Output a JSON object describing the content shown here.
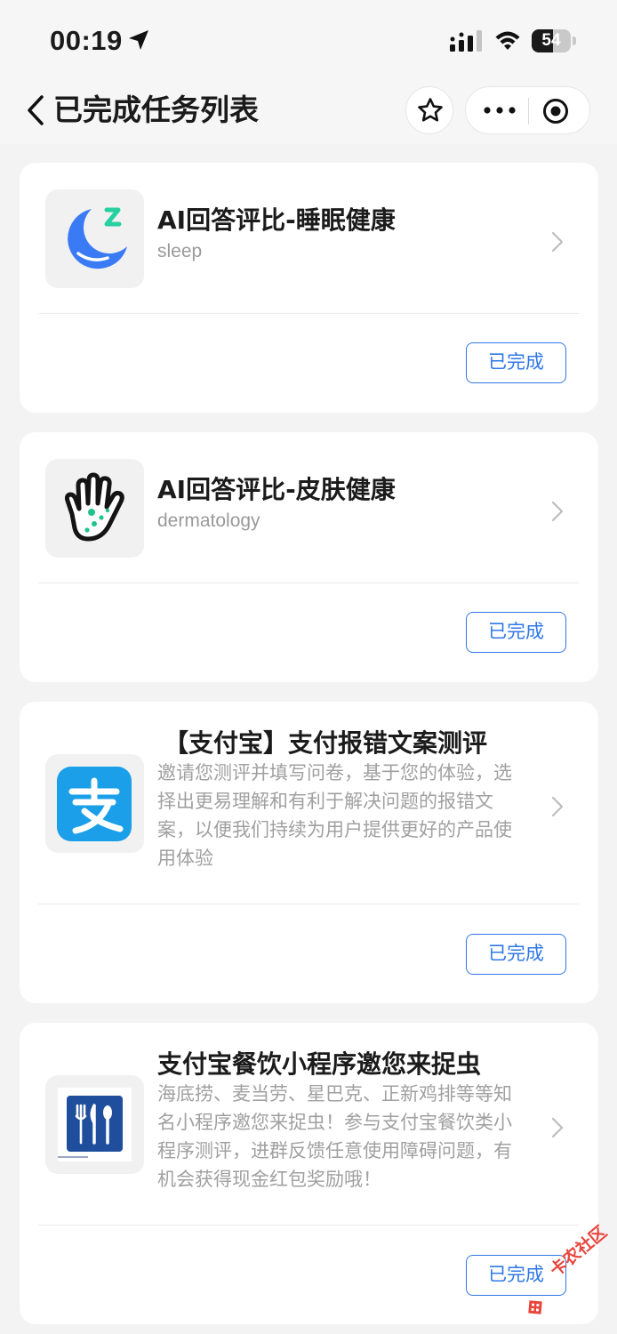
{
  "status_bar": {
    "time": "00:19",
    "battery_level": "54",
    "battery_fraction": 0.54,
    "icons": [
      "location-arrow-icon",
      "cellular-signal-icon",
      "wifi-icon",
      "battery-icon"
    ]
  },
  "nav": {
    "back_icon": "chevron-left-icon",
    "title": "已完成任务列表",
    "favorite_icon": "star-icon",
    "more_icon": "more-dots-icon",
    "close_icon": "target-close-icon"
  },
  "tasks": [
    {
      "icon": "sleep-moon-icon",
      "title": "AI回答评比-睡眠健康",
      "subtitle": "sleep",
      "status": "已完成"
    },
    {
      "icon": "hand-skin-icon",
      "title": "AI回答评比-皮肤健康",
      "subtitle": "dermatology",
      "status": "已完成"
    },
    {
      "icon": "alipay-icon",
      "title": "【支付宝】支付报错文案测评",
      "description": [
        "邀请您测评并填写问卷，基于您的体验，选",
        "择出更易理解和有利于解决问题的报错文",
        "案，以便我们持续为用户提供更好的产品使",
        "用体验"
      ],
      "status": "已完成"
    },
    {
      "icon": "restaurant-cutlery-icon",
      "title": "支付宝餐饮小程序邀您来捉虫",
      "description": [
        "海底捞、麦当劳、星巴克、正新鸡排等等知",
        "名小程序邀您来捉虫！参与支付宝餐饮类小",
        "程序测评，进群反馈任意使用障碍问题，有",
        "机会获得现金红包奖励哦！"
      ],
      "status": "已完成"
    }
  ],
  "watermark": {
    "text": "卡农社区"
  },
  "colors": {
    "accent": "#2f78e8",
    "background": "#f3f3f3",
    "card": "#ffffff",
    "secondary_text": "#9a9a9a",
    "sleep_icon_blue": "#3a7bf5",
    "sleep_icon_green": "#26d0a0",
    "alipay_blue": "#1a9fe8",
    "cutlery_blue": "#1f4e9c",
    "watermark_red": "#e8453c"
  }
}
